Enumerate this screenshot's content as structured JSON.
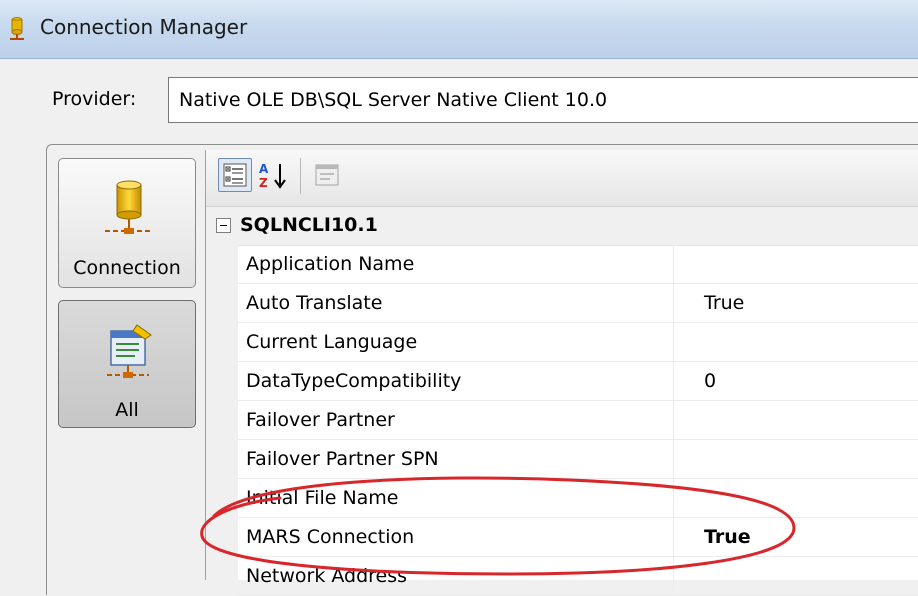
{
  "window": {
    "title": "Connection Manager"
  },
  "provider": {
    "label": "Provider:",
    "value": "Native OLE DB\\SQL Server Native Client 10.0"
  },
  "nav": {
    "items": [
      {
        "label": "Connection",
        "icon": "database-connection-icon",
        "selected": false
      },
      {
        "label": "All",
        "icon": "all-properties-icon",
        "selected": true
      }
    ]
  },
  "toolbar": {
    "buttons": [
      {
        "icon": "categorized-icon",
        "active": true
      },
      {
        "icon": "alphabetical-sort-icon",
        "active": false
      },
      {
        "icon": "property-pages-icon",
        "active": false,
        "disabled": true
      }
    ]
  },
  "grid": {
    "category": "SQLNCLI10.1",
    "properties": [
      {
        "name": "Application Name",
        "value": ""
      },
      {
        "name": "Auto Translate",
        "value": "True"
      },
      {
        "name": "Current Language",
        "value": ""
      },
      {
        "name": "DataTypeCompatibility",
        "value": "0"
      },
      {
        "name": "Failover Partner",
        "value": ""
      },
      {
        "name": "Failover Partner SPN",
        "value": ""
      },
      {
        "name": "Initial File Name",
        "value": ""
      },
      {
        "name": "MARS Connection",
        "value": "True",
        "bold": true
      },
      {
        "name": "Network Address",
        "value": ""
      }
    ]
  },
  "colors": {
    "annotation": "#d9262b",
    "selection_border": "#6d8cb5"
  }
}
